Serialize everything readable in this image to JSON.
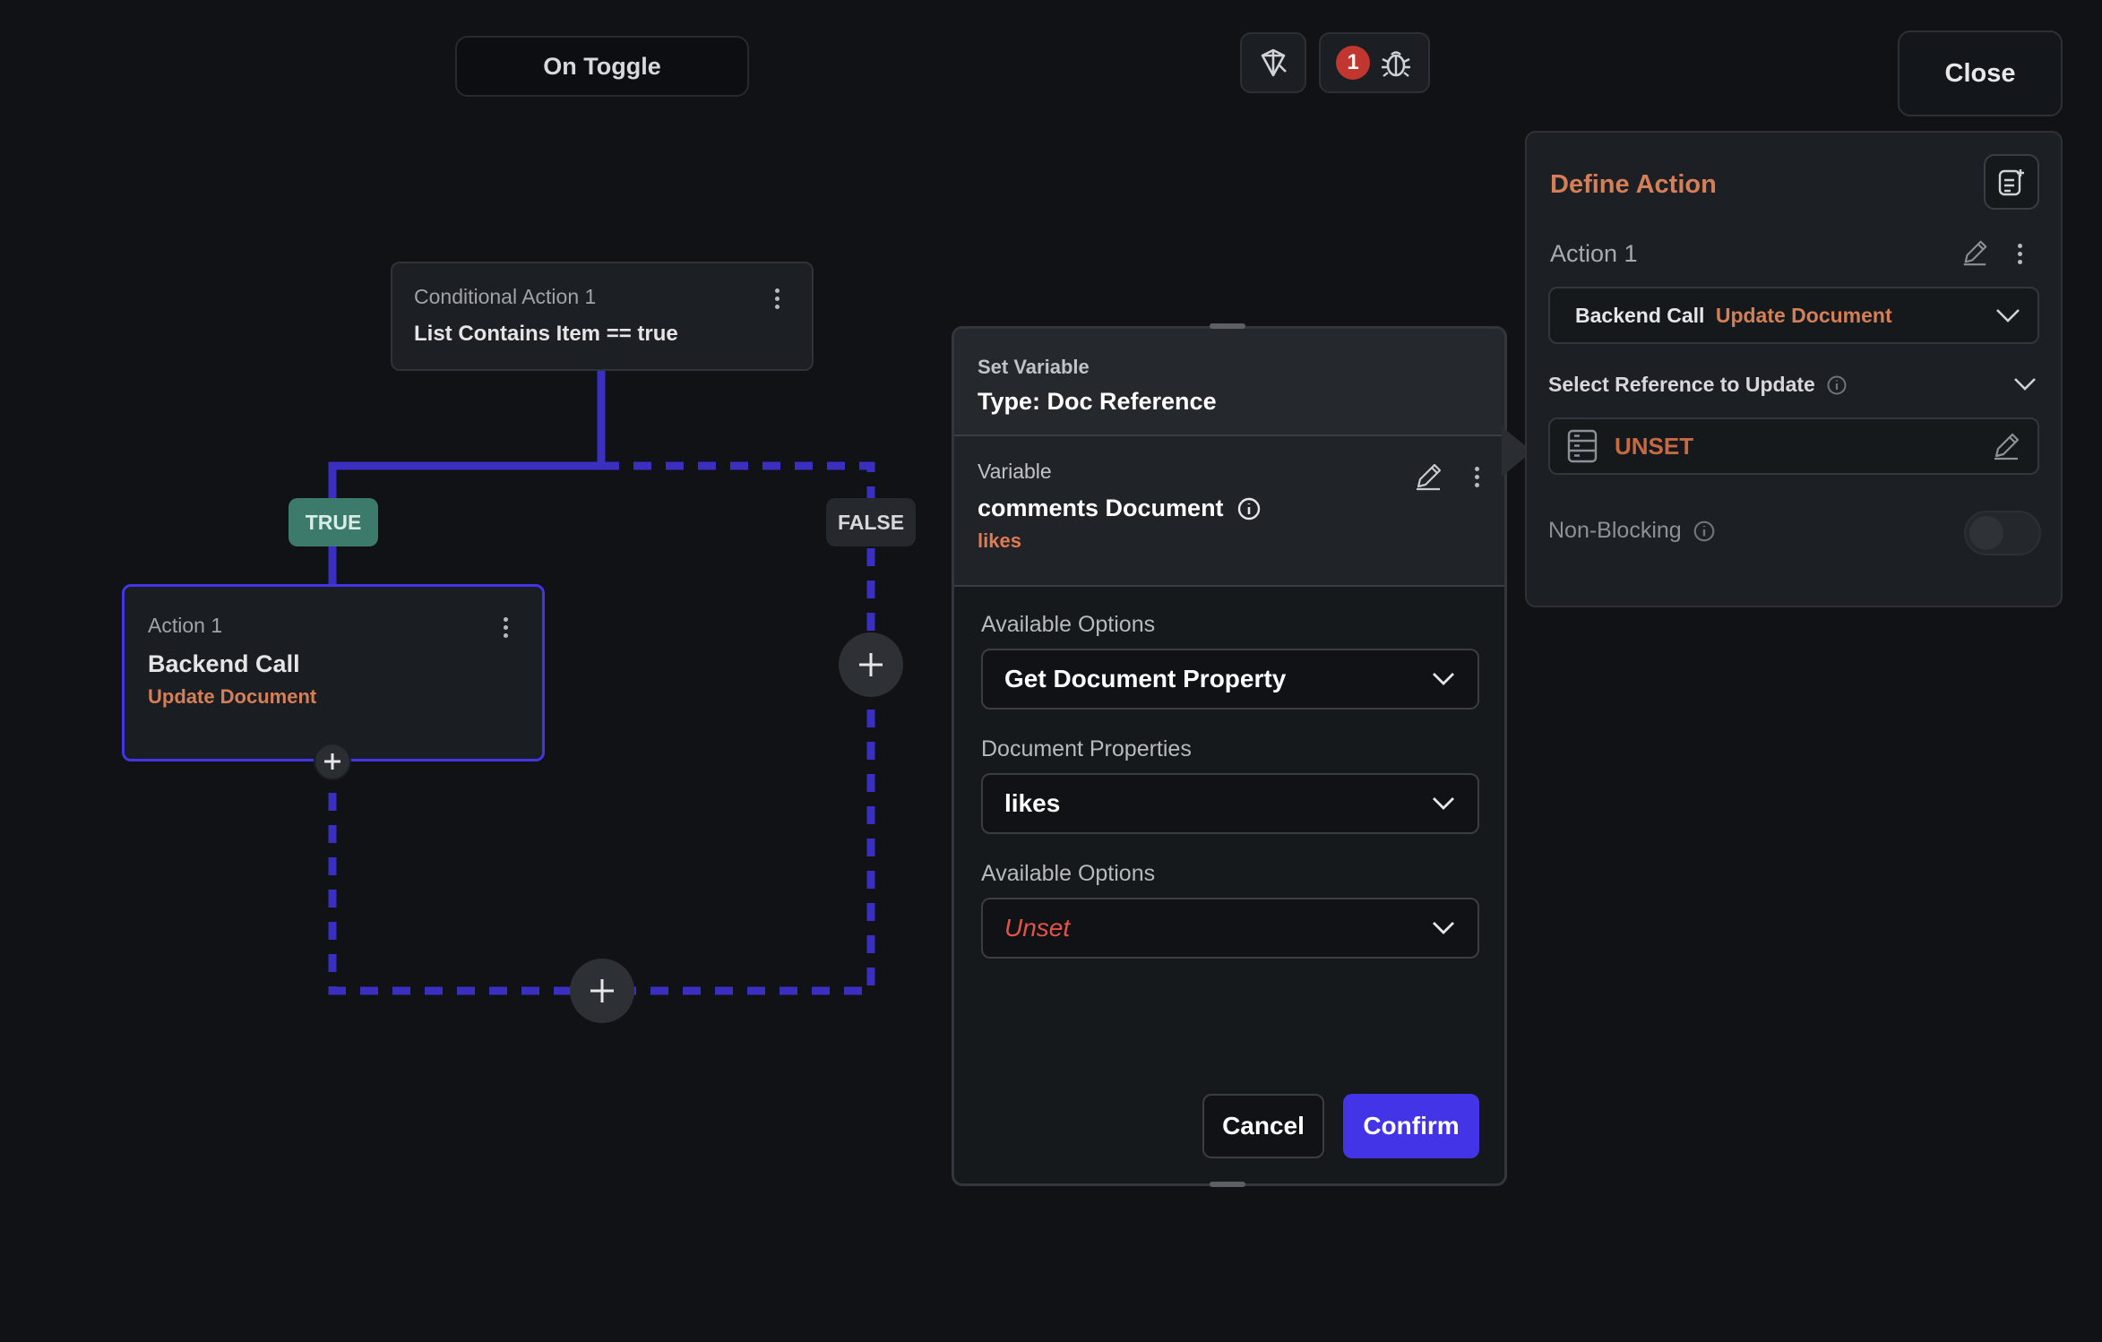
{
  "topbar": {
    "trigger_label": "On Toggle",
    "error_count": "1",
    "close_label": "Close"
  },
  "flow": {
    "conditional": {
      "kicker": "Conditional Action 1",
      "condition": "List Contains Item == true"
    },
    "true_label": "TRUE",
    "false_label": "FALSE",
    "action": {
      "kicker": "Action 1",
      "title": "Backend Call",
      "subtitle": "Update Document"
    }
  },
  "set_variable": {
    "heading": "Set Variable",
    "type": "Type: Doc Reference",
    "variable_label": "Variable",
    "variable_name": "comments Document",
    "variable_path": "likes",
    "fields": [
      {
        "label": "Available Options",
        "value": "Get Document Property"
      },
      {
        "label": "Document Properties",
        "value": "likes"
      },
      {
        "label": "Available Options",
        "value": "Unset"
      }
    ],
    "cancel_label": "Cancel",
    "confirm_label": "Confirm"
  },
  "define_action": {
    "title": "Define Action",
    "action_name": "Action 1",
    "action_type": "Backend Call",
    "action_subtype": "Update Document",
    "reference_label": "Select Reference to Update",
    "reference_value": "UNSET",
    "non_blocking_label": "Non-Blocking",
    "non_blocking_on": false
  },
  "colors": {
    "accent": "#4434e8",
    "orange": "#d47f57",
    "true_tag": "#3c7a6b",
    "error": "#c1362f",
    "flow_line": "#3a2fc0"
  }
}
